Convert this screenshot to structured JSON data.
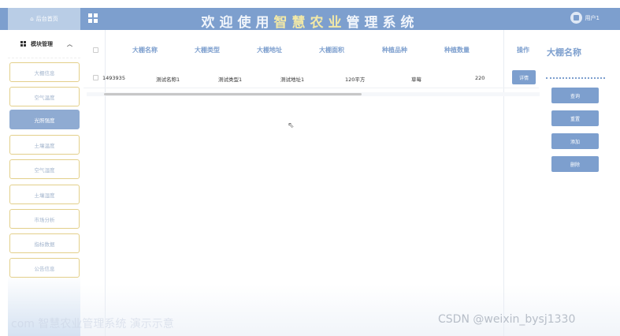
{
  "header": {
    "home_label": "后台首页",
    "title_part1": "欢迎使用",
    "title_part2": "智慧农业",
    "title_part3": "管理系统",
    "user_label": "用户1"
  },
  "sidebar": {
    "section_title": "模块管理",
    "items": [
      {
        "label": "大棚信息",
        "active": false
      },
      {
        "label": "空气温度",
        "active": false
      },
      {
        "label": "光照强度",
        "active": true
      },
      {
        "label": "土壤温度",
        "active": false
      },
      {
        "label": "空气湿度",
        "active": false
      },
      {
        "label": "土壤湿度",
        "active": false
      },
      {
        "label": "市场分析",
        "active": false
      },
      {
        "label": "指标数据",
        "active": false
      },
      {
        "label": "公告信息",
        "active": false
      }
    ]
  },
  "table": {
    "columns": [
      "大棚名称",
      "大棚类型",
      "大棚地址",
      "大棚面积",
      "种植品种",
      "种植数量",
      "操作"
    ],
    "rows": [
      {
        "id": "1493935",
        "name": "测试名称1",
        "type": "测试类型1",
        "address": "测试地址1",
        "area": "120平方",
        "variety": "草莓",
        "quantity": "220",
        "action_label": "详情"
      }
    ]
  },
  "search_panel": {
    "field_label": "大棚名称",
    "buttons": [
      "查询",
      "重置",
      "添加",
      "删除"
    ]
  },
  "watermark": {
    "left": "com 智慧农业管理系统 演示示意",
    "right": "CSDN @weixin_bysj1330"
  },
  "colors": {
    "primary": "#7d9fce",
    "header_bg": "#7d9fce",
    "nav_border": "#e3cf8a",
    "title_accent": "#f3e9a6"
  }
}
